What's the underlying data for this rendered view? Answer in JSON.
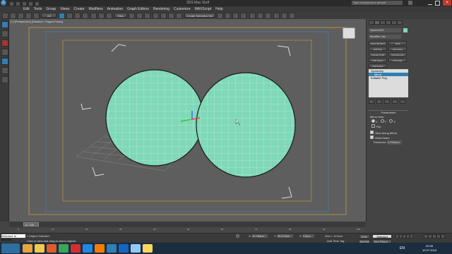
{
  "window": {
    "app_icon": "3ds-max-logo",
    "title_path": "3DS Max Stuff",
    "search_placeholder": "Type a keyword or phrase",
    "controls": [
      "minimize-icon",
      "maximize-icon",
      "close-icon"
    ]
  },
  "menu": {
    "items": [
      "Edit",
      "Tools",
      "Group",
      "Views",
      "Create",
      "Modifiers",
      "Animation",
      "Graph Editors",
      "Rendering",
      "Customize",
      "MAXScript",
      "Help"
    ]
  },
  "toolbar": {
    "selection_filter": "All",
    "view_dropdown": "View",
    "named_selection": "Create Selection Set"
  },
  "viewport": {
    "label": "[+] [Perspective] [Shaded + Edged Faces]",
    "viewcube": "viewcube-icon",
    "sphere_color": "#7fd8b8"
  },
  "command_panel": {
    "object_name": "Sphere002",
    "modifier_list_label": "Modifier List",
    "quick_buttons": [
      "Select By Mesh",
      "Shell",
      "Edit Poly",
      "Symmetry",
      "Unwrap UVW",
      "TurboSmooth",
      "FFD Select",
      "UVW Map",
      "FFD 2x2x2"
    ],
    "stack": [
      "Symmetry",
      "Mirror",
      "Editable Poly"
    ],
    "parameters_title": "Parameters",
    "mirror_axis_label": "Mirror Axis:",
    "axes": [
      "X",
      "Y",
      "Z"
    ],
    "flip_label": "Flip",
    "slice_label": "Slice Along Mirror",
    "weld_label": "Weld Seam",
    "threshold_label": "Threshold:",
    "threshold_value": "0.254mm"
  },
  "timeline": {
    "frame_readout": "0 / 100",
    "ticks": [
      "0",
      "10",
      "20",
      "30",
      "40",
      "50",
      "60",
      "70",
      "80",
      "90",
      "100"
    ]
  },
  "status_bar": {
    "selection": "1 Object Selected",
    "prompt": "Click or click-and-drag to select objects",
    "x_label": "X:",
    "x_value": "10.784cm",
    "y_label": "Y:",
    "y_value": "50.6764m",
    "z_label": "Z:",
    "z_value": "0.0cm",
    "grid": "Grid = 10.0cm",
    "autokey": "Auto Key",
    "selected": "Selected",
    "add_time_tag": "Add Time Tag",
    "setkey": "Set Key",
    "key_filters": "Key Filters...",
    "welcome": "Welcome to MAXScr"
  },
  "taskbar": {
    "apps": [
      "ie-icon",
      "explorer-icon",
      "media-icon",
      "chrome-icon",
      "opera-icon",
      "skype-icon",
      "vlc-icon",
      "3dsmax-icon",
      "photoshop-icon",
      "paint-icon",
      "folder-icon"
    ],
    "tray_lang": "EN",
    "time": "20:06",
    "date": "10.07.2015"
  }
}
